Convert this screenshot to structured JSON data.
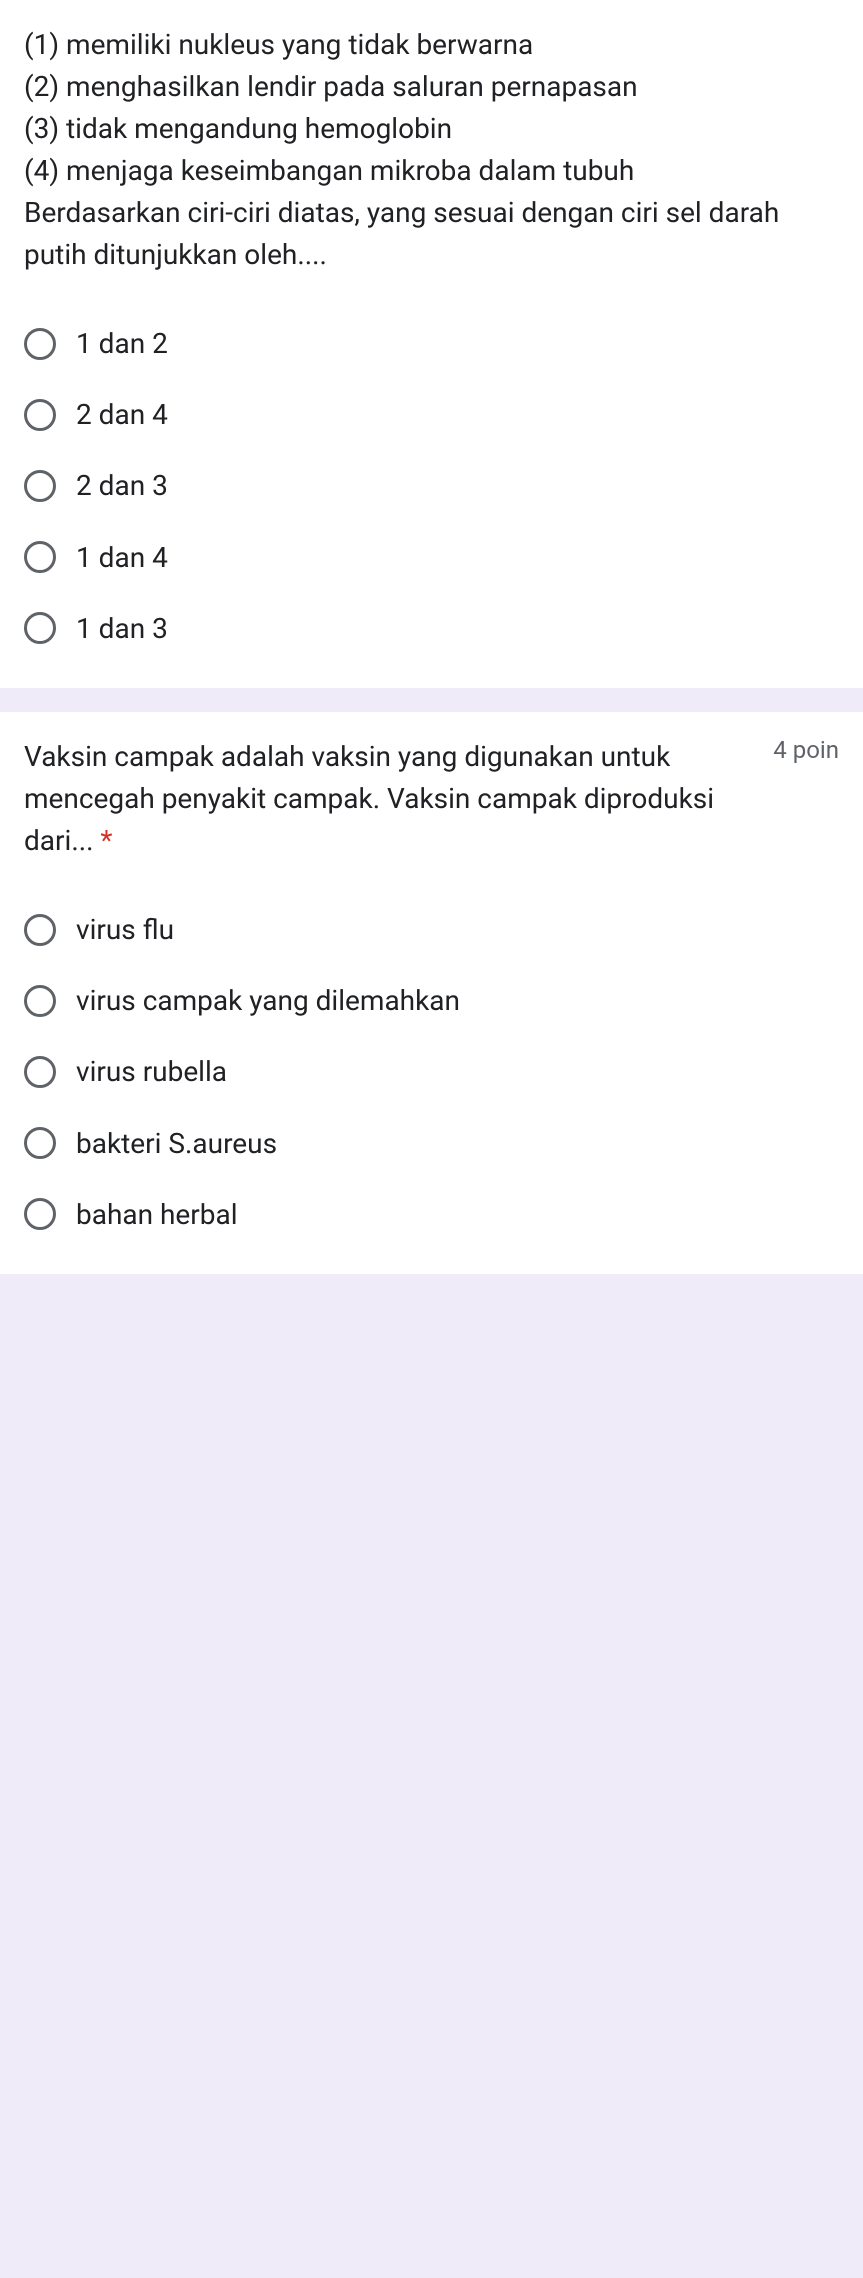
{
  "question1": {
    "text": "(1) memiliki nukleus yang tidak berwarna\n(2) menghasilkan lendir pada saluran pernapasan\n(3) tidak mengandung hemoglobin\n(4) menjaga keseimbangan mikroba dalam tubuh\nBerdasarkan ciri-ciri diatas, yang sesuai dengan ciri sel darah putih ditunjukkan oleh....",
    "options": [
      "1 dan 2",
      "2 dan 4",
      "2 dan 3",
      "1 dan 4",
      "1 dan 3"
    ]
  },
  "question2": {
    "text": "Vaksin campak adalah vaksin yang digunakan untuk mencegah penyakit campak. Vaksin campak diproduksi dari...",
    "required": "*",
    "points": "4 poin",
    "options": [
      "virus flu",
      "virus campak yang dilemahkan",
      "virus rubella",
      "bakteri S.aureus",
      "bahan herbal"
    ]
  }
}
